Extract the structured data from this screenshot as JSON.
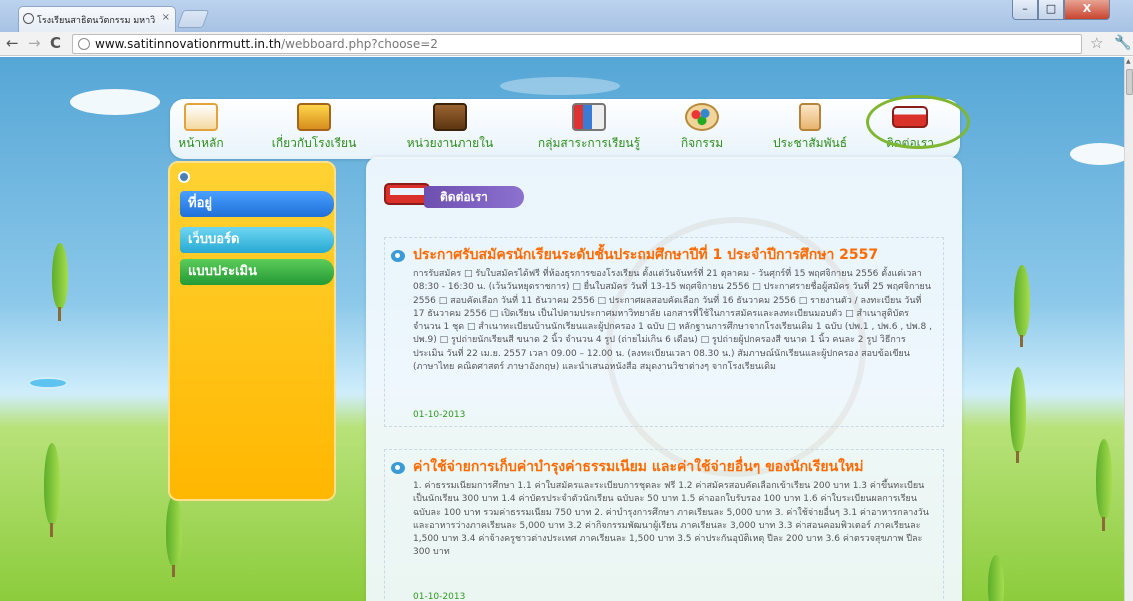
{
  "browser": {
    "tab_title": "โรงเรียนสาธิตนวัตกรรม มหาวิ",
    "tab_close": "×",
    "url_host": "www.satitinnovationrmutt.in.th",
    "url_path": "/webboard.php?choose=2",
    "back": "←",
    "forward": "→",
    "reload": "C",
    "star": "☆",
    "wrench": "🔧",
    "win_min": "–",
    "win_max": "□",
    "win_close": "X"
  },
  "nav": {
    "items": [
      {
        "label": "หน้าหลัก",
        "icon": "school-building-icon"
      },
      {
        "label": "เกี่ยวกับโรงเรียน",
        "icon": "school-house-icon"
      },
      {
        "label": "หน่วยงานภายใน",
        "icon": "briefcase-icon"
      },
      {
        "label": "กลุ่มสาระการเรียนรู้",
        "icon": "books-icon"
      },
      {
        "label": "กิจกรรม",
        "icon": "palette-icon"
      },
      {
        "label": "ประชาสัมพันธ์",
        "icon": "document-stack-icon"
      },
      {
        "label": "ติดต่อเรา",
        "icon": "bus-icon"
      }
    ]
  },
  "sidebar": {
    "items": [
      {
        "label": "ที่อยู่",
        "color": "#2b7fe0"
      },
      {
        "label": "เว็บบอร์ด",
        "color": "#2eb3d9"
      },
      {
        "label": "แบบประเมิน",
        "color": "#2aa040"
      }
    ]
  },
  "content": {
    "banner_label": "ติดต่อเรา",
    "posts": [
      {
        "title": "ประกาศรับสมัครนักเรียนระดับชั้นประถมศึกษาปีที่ 1 ประจำปีการศึกษา 2557",
        "body": "การรับสมัคร □ รับใบสมัครได้ฟรี ที่ห้องธุรการของโรงเรียน ตั้งแต่วันจันทร์ที่ 21 ตุลาคม - วันศุกร์ที่ 15 พฤศจิกายน 2556 ตั้งแต่เวลา 08:30 - 16:30 น. (เว้นวันหยุดราชการ) □ ยื่นใบสมัคร วันที่ 13-15 พฤศจิกายน 2556 □ ประกาศรายชื่อผู้สมัคร วันที่ 25 พฤศจิกายน 2556 □ สอบคัดเลือก วันที่ 11 ธันวาคม 2556 □ ประกาศผลสอบคัดเลือก วันที่ 16 ธันวาคม 2556 □ รายงานตัว / ลงทะเบียน วันที่ 17 ธันวาคม 2556 □ เปิดเรียน เป็นไปตามประกาศมหาวิทยาลัย เอกสารที่ใช้ในการสมัครและลงทะเบียนมอบตัว □ สำเนาสูติบัตร จำนวน 1 ชุด □ สำเนาทะเบียนบ้านนักเรียนและผู้ปกครอง 1 ฉบับ □ หลักฐานการศึกษาจากโรงเรียนเดิม 1 ฉบับ (ปพ.1 , ปพ.6 , ปพ.8 , ปพ.9) □ รูปถ่ายนักเรียนสี ขนาด 2 นิ้ว จำนวน 4 รูป (ถ่ายไม่เกิน 6 เดือน) □ รูปถ่ายผู้ปกครองสี ขนาด 1 นิ้ว คนละ 2 รูป วิธีการประเมิน วันที่ 22 เม.ย. 2557 เวลา 09.00 – 12.00 น. (ลงทะเบียนเวลา 08.30 น.) สัมภาษณ์นักเรียนและผู้ปกครอง สอบข้อเขียน (ภาษาไทย คณิตศาสตร์ ภาษาอังกฤษ) และนำเสนอหนังสือ สมุดงานวิชาต่างๆ จากโรงเรียนเดิม",
        "date": "01-10-2013"
      },
      {
        "title": "ค่าใช้จ่ายการเก็บค่าบำรุงค่าธรรมเนียม และค่าใช้จ่ายอื่นๆ ของนักเรียนใหม่",
        "body": "1. ค่าธรรมเนียมการศึกษา 1.1 ค่าใบสมัครและระเบียบการชุดละ ฟรี 1.2 ค่าสมัครสอบคัดเลือกเข้าเรียน 200 บาท 1.3 ค่าขึ้นทะเบียนเป็นนักเรียน 300 บาท 1.4 ค่าบัตรประจำตัวนักเรียน ฉบับละ 50 บาท 1.5 ค่าออกใบรับรอง 100 บาท 1.6 ค่าใบระเบียนผลการเรียน ฉบับละ 100 บาท รวมค่าธรรมเนียม 750 บาท 2. ค่าบำรุงการศึกษา ภาคเรียนละ 5,000 บาท 3. ค่าใช้จ่ายอื่นๆ 3.1 ค่าอาหารกลางวันและอาหารว่างภาคเรียนละ 5,000 บาท 3.2 ค่ากิจกรรมพัฒนาผู้เรียน ภาคเรียนละ 3,000 บาท 3.3 ค่าสอนคอมพิวเตอร์ ภาคเรียนละ 1,500 บาท 3.4 ค่าจ้างครูชาวต่างประเทศ ภาคเรียนละ 1,500 บาท 3.5 ค่าประกันอุบัติเหตุ ปีละ 200 บาท 3.6 ค่าตรวจสุขภาพ ปีละ 300 บาท",
        "date": "01-10-2013"
      }
    ]
  },
  "colors": {
    "nav_label": "#2f8d1b",
    "post_title": "#ff6a00",
    "date": "#2f9a1f",
    "highlight_ring": "#7fb632"
  }
}
